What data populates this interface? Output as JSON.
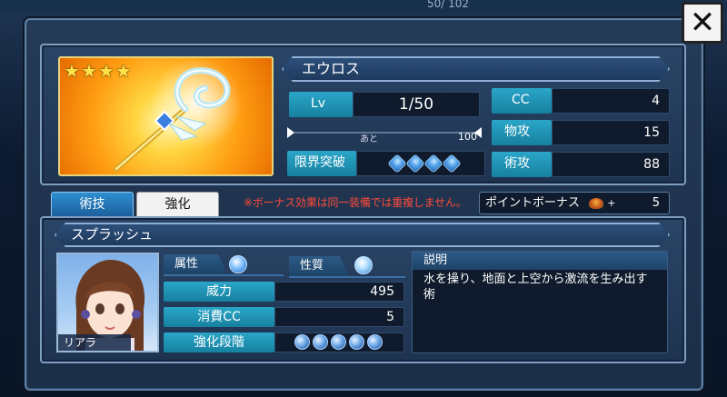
{
  "header": {
    "counter": "50/ 102",
    "close_label": "✕"
  },
  "item": {
    "stars": [
      "★",
      "★",
      "★",
      "★"
    ],
    "name": "エウロス",
    "level": {
      "label": "Lv",
      "value": "1/50",
      "remain_label": "あと",
      "remain_value": "100"
    },
    "limit_break": {
      "label": "限界突破",
      "gems": 4
    },
    "stats": [
      {
        "label": "CC",
        "value": "4"
      },
      {
        "label": "物攻",
        "value": "15"
      },
      {
        "label": "術攻",
        "value": "88"
      }
    ]
  },
  "tabs": [
    {
      "label": "術技",
      "active": true
    },
    {
      "label": "強化",
      "active": false
    }
  ],
  "notice": "※ボーナス効果は同一装備では重複しません。",
  "bonus": {
    "label": "ポイントボーナス",
    "plus": "+",
    "value": "5"
  },
  "skill": {
    "name": "スプラッシュ",
    "character": "リアラ",
    "attribute_label": "属性",
    "nature_label": "性質",
    "rows": [
      {
        "label": "威力",
        "value": "495"
      },
      {
        "label": "消費CC",
        "value": "5"
      },
      {
        "label": "強化段階",
        "orbs": 5
      }
    ],
    "desc_title": "説明",
    "description": "水を操り、地面と上空から激流を生み出す術"
  },
  "colors": {
    "accent": "#2aa6c9",
    "notice": "#ff4a3a",
    "frame": "#7f9dbf"
  }
}
